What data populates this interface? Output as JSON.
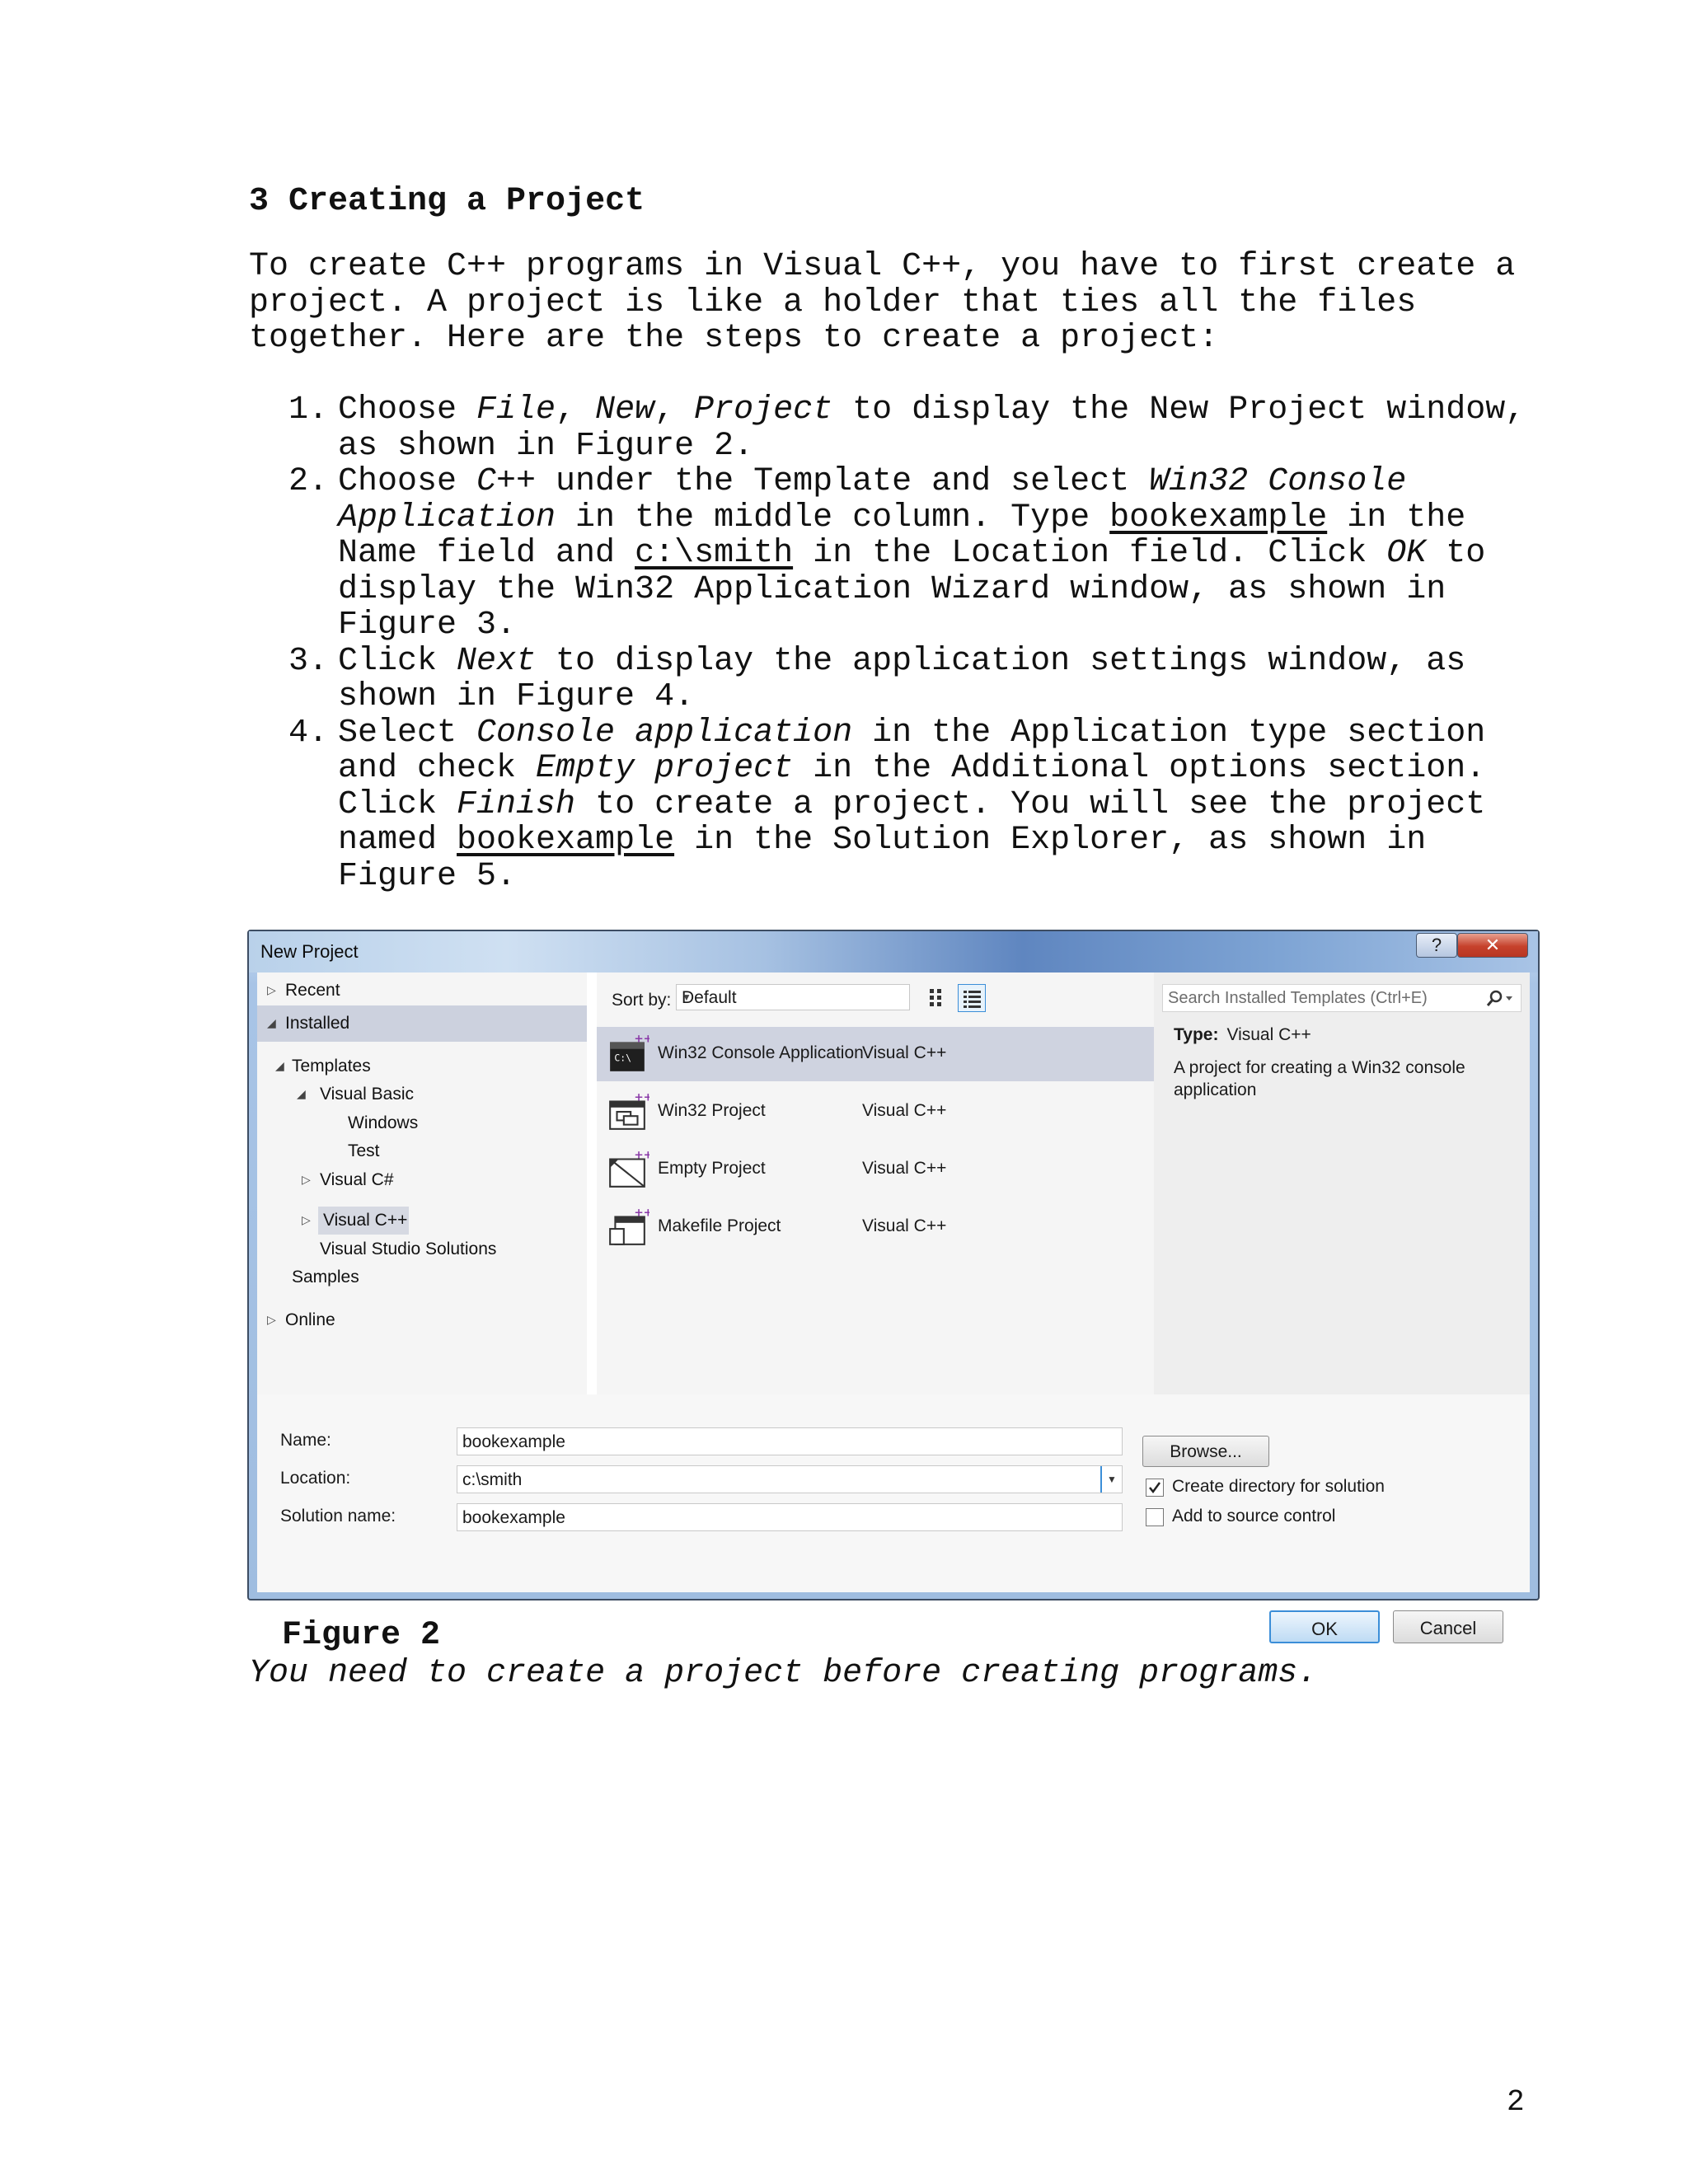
{
  "heading": "3 Creating a Project",
  "intro": "To create C++ programs in Visual C++, you have to first create a project. A project is like a holder that ties all the files together. Here are the steps to create a project:",
  "steps": [
    {
      "num": "1.",
      "parts": [
        {
          "t": "Choose "
        },
        {
          "t": "File",
          "s": "i"
        },
        {
          "t": ", "
        },
        {
          "t": "New",
          "s": "i"
        },
        {
          "t": ", "
        },
        {
          "t": "Project",
          "s": "i"
        },
        {
          "t": " to display the New Project window, as shown in Figure 2."
        }
      ]
    },
    {
      "num": "2.",
      "parts": [
        {
          "t": "Choose "
        },
        {
          "t": "C++",
          "s": "i"
        },
        {
          "t": " under the Template and select "
        },
        {
          "t": "Win32 Console Application",
          "s": "i"
        },
        {
          "t": " in the middle column. Type "
        },
        {
          "t": "bookexample",
          "s": "u"
        },
        {
          "t": " in the Name field and "
        },
        {
          "t": "c:\\smith",
          "s": "u"
        },
        {
          "t": " in the Location field. Click "
        },
        {
          "t": "OK",
          "s": "i"
        },
        {
          "t": " to display the Win32 Application Wizard window, as shown in Figure 3."
        }
      ]
    },
    {
      "num": "3.",
      "parts": [
        {
          "t": "Click "
        },
        {
          "t": "Next",
          "s": "i"
        },
        {
          "t": " to display the application settings window, as shown in Figure 4."
        }
      ]
    },
    {
      "num": "4.",
      "parts": [
        {
          "t": "Select "
        },
        {
          "t": "Console application",
          "s": "i"
        },
        {
          "t": " in the Application type section and check "
        },
        {
          "t": "Empty project",
          "s": "i"
        },
        {
          "t": " in the Additional options section. Click "
        },
        {
          "t": "Finish",
          "s": "i"
        },
        {
          "t": " to create a project. You will see the project named "
        },
        {
          "t": "bookexample",
          "s": "u"
        },
        {
          "t": " in the Solution Explorer, as shown in Figure 5."
        }
      ]
    }
  ],
  "dialog": {
    "title": "New Project",
    "help_label": "?",
    "close_label": "✕",
    "tree": {
      "recent": "Recent",
      "installed": "Installed",
      "templates": "Templates",
      "visual_basic": "Visual Basic",
      "windows": "Windows",
      "test": "Test",
      "visual_csharp": "Visual C#",
      "visual_cpp": "Visual C++",
      "vs_solutions": "Visual Studio Solutions",
      "samples": "Samples",
      "online": "Online"
    },
    "sort_by_label": "Sort by:",
    "sort_by_value": "Default",
    "templates": [
      {
        "name": "Win32 Console Application",
        "lang": "Visual C++",
        "selected": true,
        "icon": "console-app-icon"
      },
      {
        "name": "Win32 Project",
        "lang": "Visual C++",
        "selected": false,
        "icon": "win32-project-icon"
      },
      {
        "name": "Empty Project",
        "lang": "Visual C++",
        "selected": false,
        "icon": "empty-project-icon"
      },
      {
        "name": "Makefile Project",
        "lang": "Visual C++",
        "selected": false,
        "icon": "makefile-project-icon"
      }
    ],
    "search_placeholder": "Search Installed Templates (Ctrl+E)",
    "type_label": "Type:",
    "type_value": "Visual C++",
    "description": "A project for creating a Win32 console application",
    "name_label": "Name:",
    "name_value": "bookexample",
    "location_label": "Location:",
    "location_value": "c:\\smith",
    "solution_label": "Solution name:",
    "solution_value": "bookexample",
    "browse_label": "Browse...",
    "create_dir_label": "Create directory for solution",
    "create_dir_checked": true,
    "source_control_label": "Add to source control",
    "source_control_checked": false,
    "ok_label": "OK",
    "cancel_label": "Cancel"
  },
  "figure_title": "Figure 2",
  "figure_caption": "You need to create a project before creating programs.",
  "page_number": "2"
}
